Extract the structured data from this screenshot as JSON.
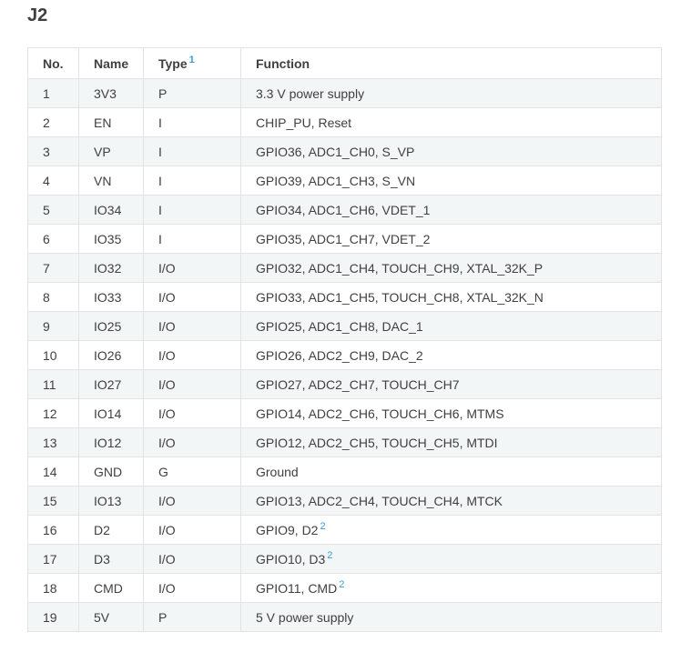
{
  "section_title": "J2",
  "columns": {
    "no": "No.",
    "name": "Name",
    "type": "Type",
    "type_footnote": "1",
    "function": "Function"
  },
  "rows": [
    {
      "no": "1",
      "name": "3V3",
      "type": "P",
      "function": "3.3 V power supply",
      "footnote": ""
    },
    {
      "no": "2",
      "name": "EN",
      "type": "I",
      "function": "CHIP_PU, Reset",
      "footnote": ""
    },
    {
      "no": "3",
      "name": "VP",
      "type": "I",
      "function": "GPIO36, ADC1_CH0, S_VP",
      "footnote": ""
    },
    {
      "no": "4",
      "name": "VN",
      "type": "I",
      "function": "GPIO39, ADC1_CH3, S_VN",
      "footnote": ""
    },
    {
      "no": "5",
      "name": "IO34",
      "type": "I",
      "function": "GPIO34, ADC1_CH6, VDET_1",
      "footnote": ""
    },
    {
      "no": "6",
      "name": "IO35",
      "type": "I",
      "function": "GPIO35, ADC1_CH7, VDET_2",
      "footnote": ""
    },
    {
      "no": "7",
      "name": "IO32",
      "type": "I/O",
      "function": "GPIO32, ADC1_CH4, TOUCH_CH9, XTAL_32K_P",
      "footnote": ""
    },
    {
      "no": "8",
      "name": "IO33",
      "type": "I/O",
      "function": "GPIO33, ADC1_CH5, TOUCH_CH8, XTAL_32K_N",
      "footnote": ""
    },
    {
      "no": "9",
      "name": "IO25",
      "type": "I/O",
      "function": "GPIO25, ADC1_CH8, DAC_1",
      "footnote": ""
    },
    {
      "no": "10",
      "name": "IO26",
      "type": "I/O",
      "function": "GPIO26, ADC2_CH9, DAC_2",
      "footnote": ""
    },
    {
      "no": "11",
      "name": "IO27",
      "type": "I/O",
      "function": "GPIO27, ADC2_CH7, TOUCH_CH7",
      "footnote": ""
    },
    {
      "no": "12",
      "name": "IO14",
      "type": "I/O",
      "function": "GPIO14, ADC2_CH6, TOUCH_CH6, MTMS",
      "footnote": ""
    },
    {
      "no": "13",
      "name": "IO12",
      "type": "I/O",
      "function": "GPIO12, ADC2_CH5, TOUCH_CH5, MTDI",
      "footnote": ""
    },
    {
      "no": "14",
      "name": "GND",
      "type": "G",
      "function": "Ground",
      "footnote": ""
    },
    {
      "no": "15",
      "name": "IO13",
      "type": "I/O",
      "function": "GPIO13, ADC2_CH4, TOUCH_CH4, MTCK",
      "footnote": ""
    },
    {
      "no": "16",
      "name": "D2",
      "type": "I/O",
      "function": "GPIO9, D2",
      "footnote": "2"
    },
    {
      "no": "17",
      "name": "D3",
      "type": "I/O",
      "function": "GPIO10, D3",
      "footnote": "2"
    },
    {
      "no": "18",
      "name": "CMD",
      "type": "I/O",
      "function": "GPIO11, CMD",
      "footnote": "2"
    },
    {
      "no": "19",
      "name": "5V",
      "type": "P",
      "function": "5 V power supply",
      "footnote": ""
    }
  ]
}
